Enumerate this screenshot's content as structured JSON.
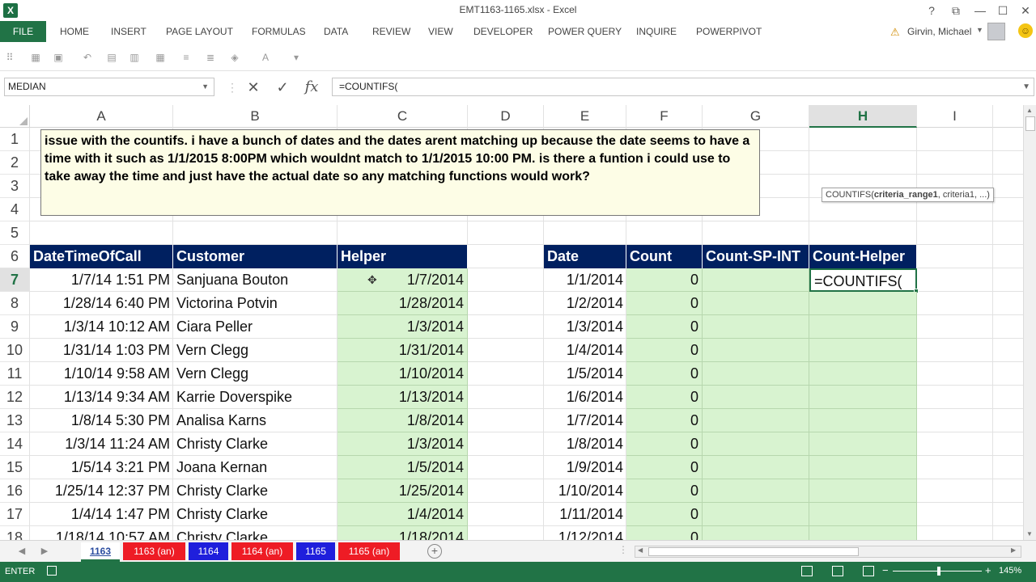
{
  "window": {
    "app_icon": "X",
    "title": "EMT1163-1165.xlsx - Excel",
    "controls": [
      "?",
      "⧉",
      "—",
      "☐",
      "✕"
    ]
  },
  "ribbon": {
    "file": "FILE",
    "tabs": [
      "HOME",
      "INSERT",
      "PAGE LAYOUT",
      "FORMULAS",
      "DATA",
      "REVIEW",
      "VIEW",
      "DEVELOPER",
      "POWER QUERY",
      "INQUIRE",
      "POWERPIVOT"
    ],
    "user": "Girvin, Michael"
  },
  "formula_bar": {
    "name_box": "MEDIAN",
    "cancel": "✕",
    "enter": "✓",
    "fx": "fx",
    "formula": "=COUNTIFS("
  },
  "columns": [
    "A",
    "B",
    "C",
    "D",
    "E",
    "F",
    "G",
    "H",
    "I"
  ],
  "rows": [
    "1",
    "2",
    "3",
    "4",
    "5",
    "6",
    "7",
    "8",
    "9",
    "10",
    "11",
    "12",
    "13",
    "14",
    "15",
    "16",
    "17",
    "18"
  ],
  "note": "issue with the countifs. i have a bunch of dates and the dates arent matching up because the date seems to have a time with it such as 1/1/2015 8:00PM which wouldnt match to 1/1/2015 10:00 PM. is there a funtion i could use to take away the time and just have the actual date so any matching functions would work?",
  "table1": {
    "headers": [
      "DateTimeOfCall",
      "Customer",
      "Helper"
    ],
    "rows": [
      [
        "1/7/14 1:51 PM",
        "Sanjuana Bouton",
        "1/7/2014"
      ],
      [
        "1/28/14 6:40 PM",
        "Victorina Potvin",
        "1/28/2014"
      ],
      [
        "1/3/14 10:12 AM",
        "Ciara Peller",
        "1/3/2014"
      ],
      [
        "1/31/14 1:03 PM",
        "Vern Clegg",
        "1/31/2014"
      ],
      [
        "1/10/14 9:58 AM",
        "Vern Clegg",
        "1/10/2014"
      ],
      [
        "1/13/14 9:34 AM",
        "Karrie Doverspike",
        "1/13/2014"
      ],
      [
        "1/8/14 5:30 PM",
        "Analisa Karns",
        "1/8/2014"
      ],
      [
        "1/3/14 11:24 AM",
        "Christy Clarke",
        "1/3/2014"
      ],
      [
        "1/5/14 3:21 PM",
        "Joana Kernan",
        "1/5/2014"
      ],
      [
        "1/25/14 12:37 PM",
        "Christy Clarke",
        "1/25/2014"
      ],
      [
        "1/4/14 1:47 PM",
        "Christy Clarke",
        "1/4/2014"
      ],
      [
        "1/18/14 10:57 AM",
        "Christy Clarke",
        "1/18/2014"
      ]
    ]
  },
  "table2": {
    "headers": [
      "Date",
      "Count",
      "Count-SP-INT",
      "Count-Helper"
    ],
    "rows": [
      [
        "1/1/2014",
        "0"
      ],
      [
        "1/2/2014",
        "0"
      ],
      [
        "1/3/2014",
        "0"
      ],
      [
        "1/4/2014",
        "0"
      ],
      [
        "1/5/2014",
        "0"
      ],
      [
        "1/6/2014",
        "0"
      ],
      [
        "1/7/2014",
        "0"
      ],
      [
        "1/8/2014",
        "0"
      ],
      [
        "1/9/2014",
        "0"
      ],
      [
        "1/10/2014",
        "0"
      ],
      [
        "1/11/2014",
        "0"
      ],
      [
        "1/12/2014",
        "0"
      ]
    ],
    "editing_value": "=COUNTIFS("
  },
  "tooltip": {
    "fn": "COUNTIFS(",
    "arg_bold": "criteria_range1",
    "rest": ", criteria1, ...)"
  },
  "sheets": [
    {
      "name": "1163",
      "color": "#ffffff",
      "active": true
    },
    {
      "name": "1163 (an)",
      "color": "#ee1c25"
    },
    {
      "name": "1164",
      "color": "#1f1fdc"
    },
    {
      "name": "1164 (an)",
      "color": "#ee1c25"
    },
    {
      "name": "1165",
      "color": "#1f1fdc"
    },
    {
      "name": "1165 (an)",
      "color": "#ee1c25"
    }
  ],
  "status": {
    "mode": "ENTER",
    "zoom": "145%"
  },
  "colors": {
    "excel_green": "#217346",
    "header_navy": "#002060",
    "helper_fill": "#d8f3d0",
    "note_fill": "#fdfde6"
  }
}
